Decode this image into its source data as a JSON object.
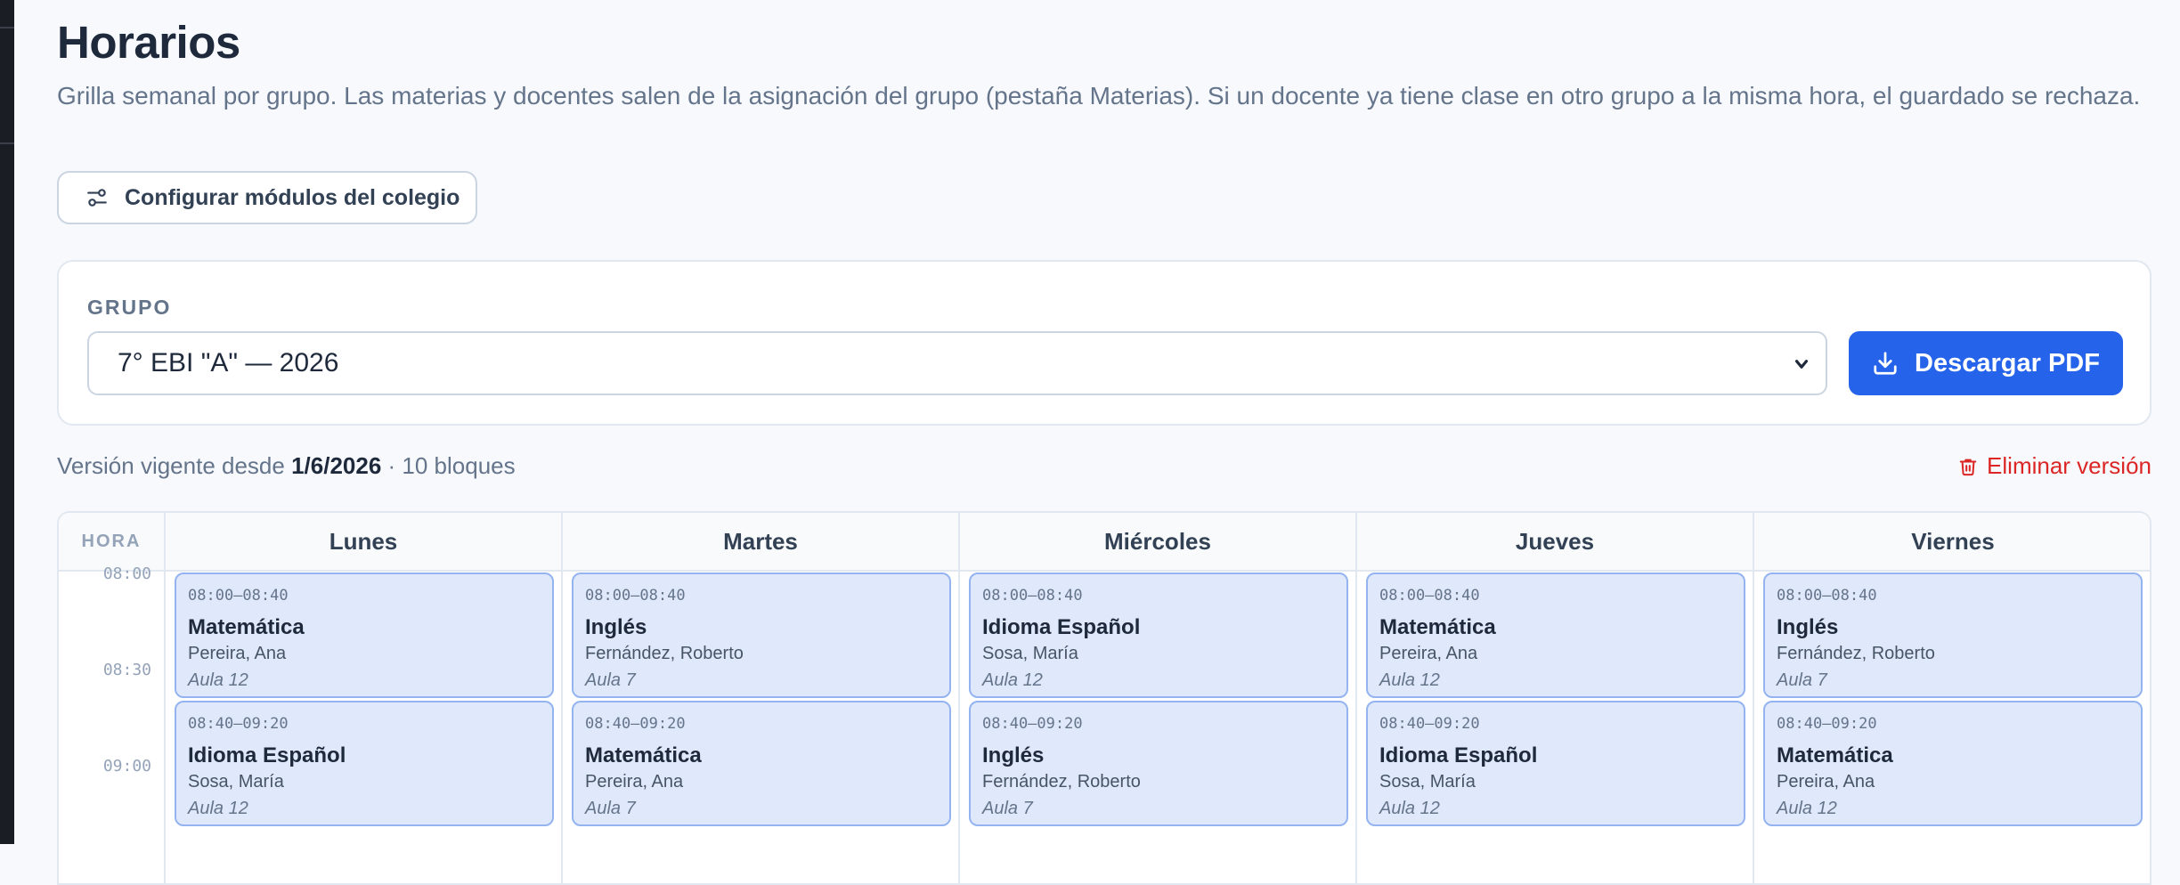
{
  "page": {
    "title": "Horarios",
    "subtitle": "Grilla semanal por grupo. Las materias y docentes salen de la asignación del grupo (pestaña Materias). Si un docente ya tiene clase en otro grupo a la misma hora, el guardado se rechaza.",
    "config_button": "Configurar módulos del colegio"
  },
  "filter": {
    "group_label": "GRUPO",
    "group_value": "7° EBI \"A\" — 2026",
    "pdf_button": "Descargar PDF"
  },
  "version": {
    "prefix": "Versión vigente desde ",
    "date": "1/6/2026",
    "suffix": " · 10 bloques",
    "delete_label": "Eliminar versión"
  },
  "grid": {
    "hora_label": "HORA",
    "days": [
      "Lunes",
      "Martes",
      "Miércoles",
      "Jueves",
      "Viernes"
    ],
    "times": [
      "08:00",
      "08:30",
      "09:00"
    ],
    "slots": [
      {
        "range": "08:00–08:40",
        "blocks": [
          {
            "subject": "Matemática",
            "teacher": "Pereira, Ana",
            "room": "Aula 12"
          },
          {
            "subject": "Inglés",
            "teacher": "Fernández, Roberto",
            "room": "Aula 7"
          },
          {
            "subject": "Idioma Español",
            "teacher": "Sosa, María",
            "room": "Aula 12"
          },
          {
            "subject": "Matemática",
            "teacher": "Pereira, Ana",
            "room": "Aula 12"
          },
          {
            "subject": "Inglés",
            "teacher": "Fernández, Roberto",
            "room": "Aula 7"
          }
        ]
      },
      {
        "range": "08:40–09:20",
        "blocks": [
          {
            "subject": "Idioma Español",
            "teacher": "Sosa, María",
            "room": "Aula 12"
          },
          {
            "subject": "Matemática",
            "teacher": "Pereira, Ana",
            "room": "Aula 7"
          },
          {
            "subject": "Inglés",
            "teacher": "Fernández, Roberto",
            "room": "Aula 7"
          },
          {
            "subject": "Idioma Español",
            "teacher": "Sosa, María",
            "room": "Aula 12"
          },
          {
            "subject": "Matemática",
            "teacher": "Pereira, Ana",
            "room": "Aula 12"
          }
        ]
      }
    ]
  },
  "colors": {
    "primary": "#2563eb",
    "danger": "#dc2626",
    "block_bg": "#e0e8fb",
    "block_border": "#93b4f0"
  }
}
